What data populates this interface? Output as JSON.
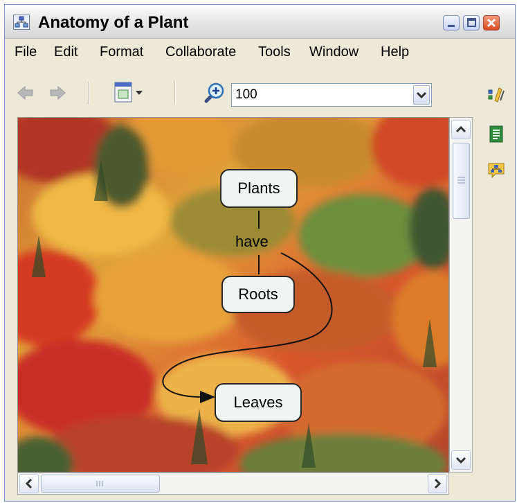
{
  "window": {
    "title": "Anatomy of a Plant"
  },
  "menu": [
    "File",
    "Edit",
    "Format",
    "Collaborate",
    "Tools",
    "Window",
    "Help"
  ],
  "toolbar": {
    "zoom_value": "100"
  },
  "concept_map": {
    "concepts": [
      "Plants",
      "Roots",
      "Leaves"
    ],
    "linking_phrase": "have",
    "background": "autumn forest photograph"
  },
  "colors": {
    "canvas_border": "#8f8f8f",
    "concept_fill": "#eef5f3",
    "titlebar": "#e9e9ea"
  },
  "icons": [
    "concept-map-app-icon",
    "back-arrow-icon",
    "forward-arrow-icon",
    "window-layout-icon",
    "zoom-in-icon",
    "styles-icon",
    "document-list-icon",
    "map-overview-icon"
  ]
}
